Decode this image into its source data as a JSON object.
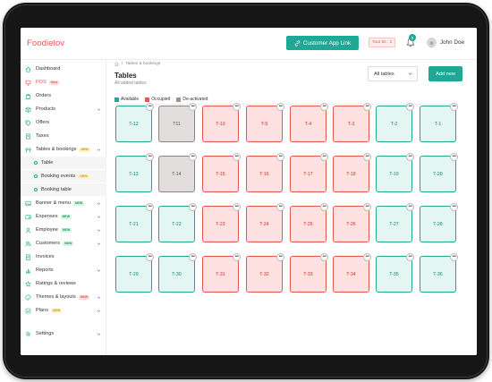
{
  "app": {
    "brand": "Foodielov"
  },
  "header": {
    "cta_label": "Customer App Link",
    "id_badge": "Your ID : 2",
    "notification_count": "0",
    "user_name": "John Doe"
  },
  "sidebar": {
    "items": [
      {
        "label": "Dashboard",
        "icon": "home-icon",
        "tag": null,
        "chevron": false
      },
      {
        "label": "POS",
        "icon": "pos-icon",
        "tag": "New",
        "tag_color": "red",
        "chevron": false,
        "active": true
      },
      {
        "label": "Orders",
        "icon": "bag-icon",
        "tag": null,
        "chevron": false
      },
      {
        "label": "Products",
        "icon": "box-icon",
        "tag": null,
        "chevron": true
      },
      {
        "label": "Offers",
        "icon": "tag-icon",
        "tag": null,
        "chevron": false
      },
      {
        "label": "Taxes",
        "icon": "receipt-icon",
        "tag": null,
        "chevron": false
      },
      {
        "label": "Tables & bookings",
        "icon": "table-icon",
        "tag": "NEW",
        "tag_color": "yellow",
        "chevron": true
      },
      {
        "label": "Table",
        "sub": true
      },
      {
        "label": "Booking events",
        "sub": true,
        "tag": "NEW",
        "tag_color": "yellow"
      },
      {
        "label": "Booking table",
        "sub": true
      },
      {
        "label": "Banner & menu",
        "icon": "image-icon",
        "tag": "NEW",
        "tag_color": "green",
        "chevron": true
      },
      {
        "label": "Expenses",
        "icon": "wallet-icon",
        "tag": "NEW",
        "tag_color": "green",
        "chevron": true
      },
      {
        "label": "Employee",
        "icon": "user-icon",
        "tag": "NEW",
        "tag_color": "green",
        "chevron": true
      },
      {
        "label": "Customers",
        "icon": "users-icon",
        "tag": "NEW",
        "tag_color": "green",
        "chevron": true
      },
      {
        "label": "Invoices",
        "icon": "invoice-icon",
        "tag": null,
        "chevron": false
      },
      {
        "label": "Reports",
        "icon": "chart-icon",
        "tag": null,
        "chevron": true
      },
      {
        "label": "Ratings & reviews",
        "icon": "star-icon",
        "tag": null,
        "chevron": false
      },
      {
        "label": "Themes & layouts",
        "icon": "palette-icon",
        "tag": "NEW",
        "tag_color": "red",
        "chevron": true
      },
      {
        "label": "Plans",
        "icon": "plan-icon",
        "tag": "NEW",
        "tag_color": "yellow",
        "chevron": true
      },
      {
        "label": "Settings",
        "icon": "gear-icon",
        "tag": null,
        "chevron": true
      }
    ]
  },
  "main": {
    "breadcrumb": "Tables & bookings",
    "title": "Tables",
    "subtitle": "All added tables",
    "filter_label": "All tables",
    "add_label": "Add new",
    "legend": [
      {
        "label": "Available",
        "color": "#1fa896"
      },
      {
        "label": "Occupied",
        "color": "#e8554e"
      },
      {
        "label": "De-activated",
        "color": "#9a9393"
      }
    ],
    "more_label": "•••",
    "tables": [
      {
        "name": "T-12",
        "status": "available"
      },
      {
        "name": "T11",
        "status": "deactivated"
      },
      {
        "name": "T-10",
        "status": "occupied"
      },
      {
        "name": "T-5",
        "status": "occupied"
      },
      {
        "name": "T-4",
        "status": "occupied"
      },
      {
        "name": "T-3",
        "status": "occupied"
      },
      {
        "name": "T-2",
        "status": "available"
      },
      {
        "name": "T-1",
        "status": "available"
      },
      {
        "name": "T-13",
        "status": "available"
      },
      {
        "name": "T-14",
        "status": "deactivated"
      },
      {
        "name": "T-15",
        "status": "occupied"
      },
      {
        "name": "T-16",
        "status": "occupied"
      },
      {
        "name": "T-17",
        "status": "occupied"
      },
      {
        "name": "T-18",
        "status": "occupied"
      },
      {
        "name": "T-19",
        "status": "available"
      },
      {
        "name": "T-20",
        "status": "available"
      },
      {
        "name": "T-21",
        "status": "available"
      },
      {
        "name": "T-22",
        "status": "available"
      },
      {
        "name": "T-23",
        "status": "occupied"
      },
      {
        "name": "T-24",
        "status": "occupied"
      },
      {
        "name": "T-25",
        "status": "occupied"
      },
      {
        "name": "T-26",
        "status": "occupied"
      },
      {
        "name": "T-27",
        "status": "available"
      },
      {
        "name": "T-28",
        "status": "available"
      },
      {
        "name": "T-29",
        "status": "available"
      },
      {
        "name": "T-30",
        "status": "available"
      },
      {
        "name": "T-31",
        "status": "occupied"
      },
      {
        "name": "T-32",
        "status": "occupied"
      },
      {
        "name": "T-33",
        "status": "occupied"
      },
      {
        "name": "T-34",
        "status": "occupied"
      },
      {
        "name": "T-35",
        "status": "available"
      },
      {
        "name": "T-36",
        "status": "available"
      }
    ]
  }
}
